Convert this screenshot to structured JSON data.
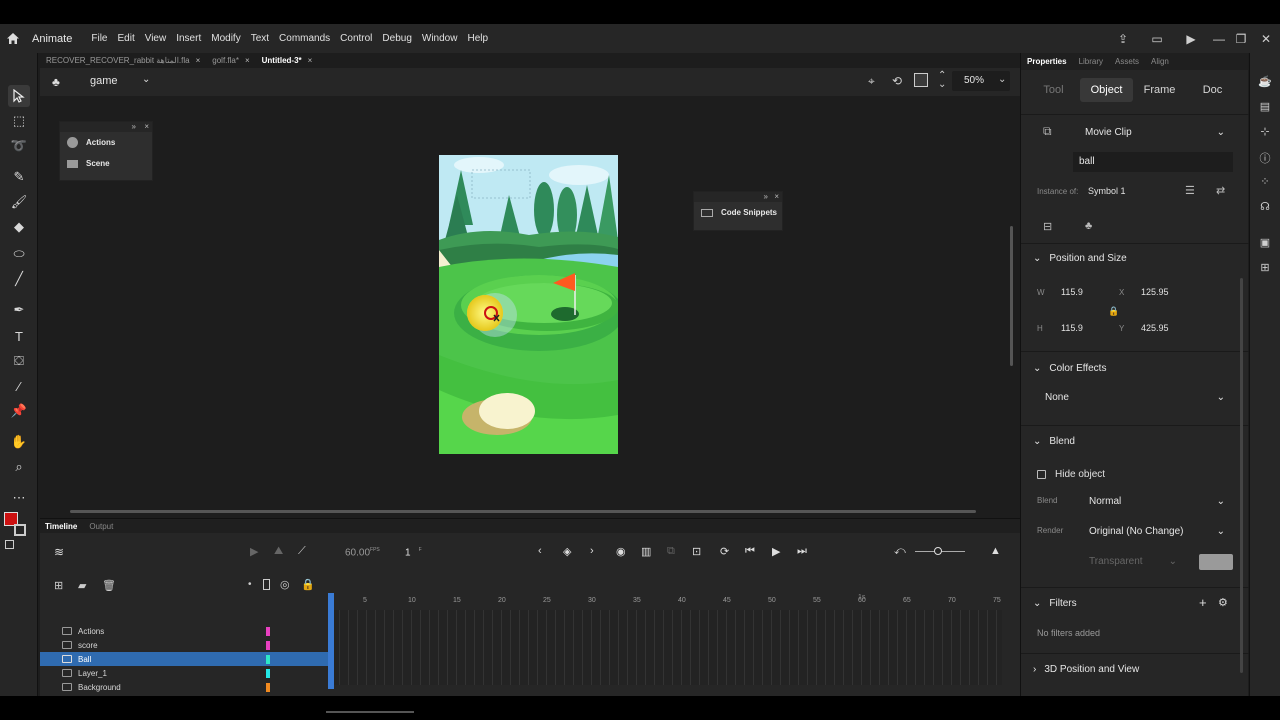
{
  "menubar": {
    "app_name": "Animate",
    "menus": [
      "File",
      "Edit",
      "View",
      "Insert",
      "Modify",
      "Text",
      "Commands",
      "Control",
      "Debug",
      "Window",
      "Help"
    ]
  },
  "doc_tabs": [
    {
      "label": "RECOVER_RECOVER_rabbit المتاهة.fla",
      "active": false
    },
    {
      "label": "golf.fla*",
      "active": false
    },
    {
      "label": "Untitled-3*",
      "active": true
    }
  ],
  "scene": {
    "name": "game",
    "zoom": "50%"
  },
  "floating_panels": {
    "actions_label": "Actions",
    "scene_label": "Scene",
    "snippets_label": "Code Snippets"
  },
  "timeline": {
    "tab_timeline": "Timeline",
    "tab_output": "Output",
    "fps": "60.00",
    "fps_unit": "FPS",
    "frame": "1",
    "frame_unit": "F",
    "ruler_ticks": [
      "5",
      "10",
      "15",
      "20",
      "25",
      "30",
      "35",
      "40",
      "45",
      "50",
      "55",
      "60",
      "65",
      "70",
      "75"
    ],
    "second_marker": "1s",
    "layers": [
      {
        "name": "Actions",
        "color": "#e840c0",
        "selected": false
      },
      {
        "name": "score",
        "color": "#e840c0",
        "selected": false
      },
      {
        "name": "Ball",
        "color": "#2ee8c8",
        "selected": true
      },
      {
        "name": "Layer_1",
        "color": "#24e8e8",
        "selected": false
      },
      {
        "name": "Background",
        "color": "#f08a20",
        "selected": false
      }
    ]
  },
  "properties": {
    "tab_properties": "Properties",
    "tab_library": "Library",
    "tab_assets": "Assets",
    "tab_align": "Align",
    "sub_tabs": [
      "Tool",
      "Object",
      "Frame",
      "Doc"
    ],
    "symbol_type": "Movie Clip",
    "instance_name": "ball",
    "instance_of_label": "Instance of:",
    "instance_of": "Symbol 1",
    "position_size_header": "Position and Size",
    "w_label": "W",
    "w": "115.9",
    "h_label": "H",
    "h": "115.9",
    "x_label": "X",
    "x": "125.95",
    "y_label": "Y",
    "y": "425.95",
    "color_effects_header": "Color Effects",
    "color_effect": "None",
    "blend_header": "Blend",
    "hide_object": "Hide object",
    "blend_label": "Blend",
    "blend_value": "Normal",
    "render_label": "Render",
    "render_value": "Original (No Change)",
    "render_bg": "Transparent",
    "filters_header": "Filters",
    "no_filters": "No filters added",
    "position_3d_header": "3D Position and View"
  },
  "colors": {
    "accent_selected": "#2f6bb0",
    "stroke_color": "#cc1111",
    "playhead": "#3a7bd5"
  }
}
